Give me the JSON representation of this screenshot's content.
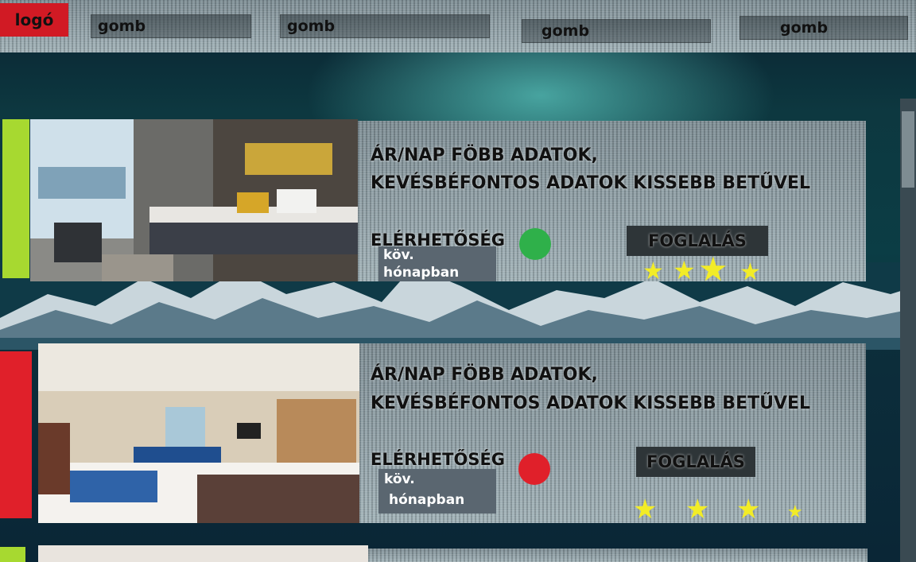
{
  "header": {
    "logo": "logó",
    "nav": [
      "gomb",
      "gomb",
      "gomb",
      "gomb"
    ]
  },
  "cards": [
    {
      "headline_line1": "ÁR/NAP FÖBB ADATOK,",
      "headline_line2": "KEVÉSBÉFONTOS ADATOK KISSEBB BETŰVEL",
      "availability_label": "ELÉRHETŐSÉG",
      "availability_status_color": "#2fb04a",
      "next_line1": "köv.",
      "next_line2": "hónapban",
      "book_label": "FOGLALÁS",
      "rating": 4,
      "accent_color": "#a7d930"
    },
    {
      "headline_line1": "ÁR/NAP FÖBB ADATOK,",
      "headline_line2": "KEVÉSBÉFONTOS ADATOK KISSEBB BETŰVEL",
      "availability_label": "ELÉRHETŐSÉG",
      "availability_status_color": "#e0202a",
      "next_line1": "köv.",
      "next_line2": "hónapban",
      "book_label": "FOGLALÁS",
      "rating": 4,
      "accent_color": "#e0202a"
    }
  ],
  "colors": {
    "star": "#f2ec27",
    "logo_bg": "#d11a24"
  }
}
